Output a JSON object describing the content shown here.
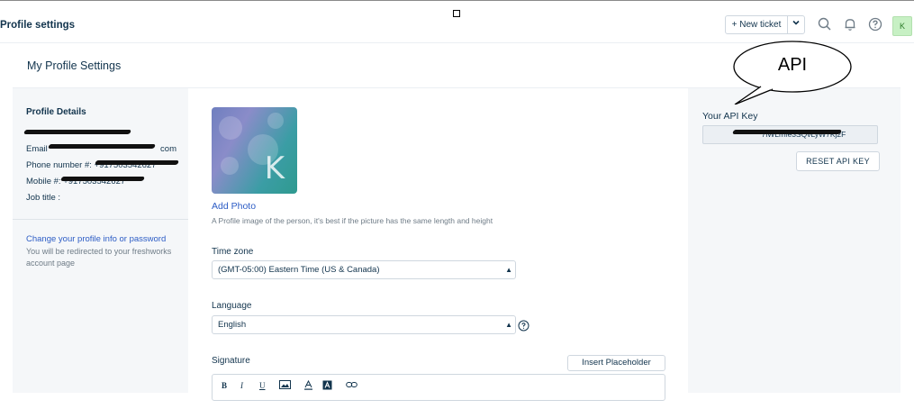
{
  "header": {
    "title": "Profile settings",
    "new_ticket_label": "+ New ticket",
    "icons": [
      "chevron-down-icon",
      "search-icon",
      "bell-icon",
      "help-icon"
    ],
    "avatar_initial": "K"
  },
  "page": {
    "section_title": "My Profile Settings"
  },
  "profile_details": {
    "title": "Profile Details",
    "email_label": "Email",
    "email_suffix": "com",
    "phone_label": "Phone number #:",
    "phone_value": "+917503542627",
    "mobile_label": "Mobile #:",
    "job_title_label": "Job title :",
    "change_link": "Change your profile info or password",
    "redirect_note": "You will be redirected to your freshworks account page"
  },
  "photo": {
    "initial": "K",
    "add_label": "Add Photo",
    "hint": "A Profile image of the person, it's best if the picture has the same length and height"
  },
  "timezone": {
    "label": "Time zone",
    "value": "(GMT-05:00) Eastern Time (US & Canada)"
  },
  "language": {
    "label": "Language",
    "value": "English"
  },
  "signature": {
    "label": "Signature",
    "insert_placeholder": "Insert Placeholder",
    "toolbar": [
      "B",
      "I",
      "U"
    ]
  },
  "api": {
    "label": "Your API Key",
    "key_visible": "7iWLmfe3SQvLyW7Kj2F",
    "reset_label": "RESET API KEY"
  },
  "annotation": {
    "callout_text": "API"
  },
  "colors": {
    "accent": "#2c5cc5",
    "text": "#12344d",
    "panel": "#f5f7f9",
    "avatar_bg": "#c7f0c4"
  }
}
